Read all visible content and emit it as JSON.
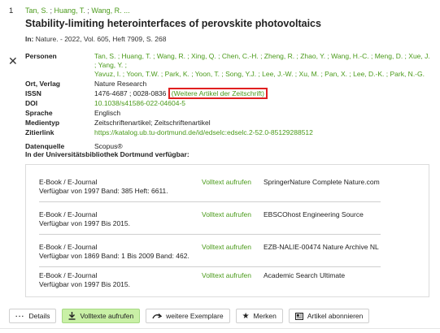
{
  "result": {
    "number": "1",
    "authors": [
      "Tan, S.",
      "Huang, T.",
      "Wang, R. ..."
    ],
    "title": "Stability-limiting heterointerfaces of perovskite photovoltaics",
    "source_label": "In:",
    "source_text": "Nature. - 2022, Vol. 605, Heft 7909, S. 268"
  },
  "details": {
    "personen_label": "Personen",
    "personen_line1": "Tan, S. ; Huang, T. ; Wang, R. ; Xing, Q. ; Chen, C.-H. ; Zheng, R. ; Zhao, Y. ; Wang, H.-C. ; Meng, D. ; Xue, J. ; Yang, Y. ;",
    "personen_line2": "Yavuz, I. ; Yoon, T.W. ; Park, K. ; Yoon, T. ; Song, Y.J. ; Lee, J.-W. ; Xu, M. ; Pan, X. ; Lee, D.-K. ; Park, N.-G.",
    "ort_label": "Ort, Verlag",
    "ort_value": "Nature Research",
    "issn_label": "ISSN",
    "issn_value": "1476-4687 ; 0028-0836",
    "issn_link": "(Weitere Artikel der Zeitschrift)",
    "doi_label": "DOI",
    "doi_value": "10.1038/s41586-022-04604-5",
    "sprache_label": "Sprache",
    "sprache_value": "Englisch",
    "medientyp_label": "Medientyp",
    "medientyp_value": "Zeitschriftenartikel; Zeitschriftenartikel",
    "zitierlink_label": "Zitierlink",
    "zitierlink_value": "https://katalog.ub.tu-dortmund.de/id/edselc:edselc.2-52.0-85129288512",
    "datenquelle_label": "Datenquelle",
    "datenquelle_value": "Scopus®"
  },
  "availability_title": "In der Universitätsbibliothek Dortmund verfügbar:",
  "holdings": [
    {
      "type": "E-Book / E-Journal",
      "range": "Verfügbar von 1997 Band: 385 Heft: 6611.",
      "link": "Volltext aufrufen",
      "provider": "SpringerNature Complete Nature.com"
    },
    {
      "type": "E-Book / E-Journal",
      "range": "Verfügbar von 1997 Bis 2015.",
      "link": "Volltext aufrufen",
      "provider": "EBSCOhost Engineering Source"
    },
    {
      "type": "E-Book / E-Journal",
      "range": "Verfügbar von 1869 Band: 1 Bis 2009 Band: 462.",
      "link": "Volltext aufrufen",
      "provider": "EZB-NALIE-00474 Nature Archive NL"
    },
    {
      "type": "E-Book / E-Journal",
      "range": "Verfügbar von 1997 Bis 2015.",
      "link": "Volltext aufrufen",
      "provider": "Academic Search Ultimate"
    }
  ],
  "buttons": {
    "details": "Details",
    "volltexte": "Volltexte aufrufen",
    "exemplare": "weitere Exemplare",
    "merken": "Merken",
    "abonnieren": "Artikel abonnieren"
  },
  "colors": {
    "accent_green": "#4a9a1a",
    "highlight_red": "#e02020",
    "primary_button": "#c9f0a6"
  }
}
